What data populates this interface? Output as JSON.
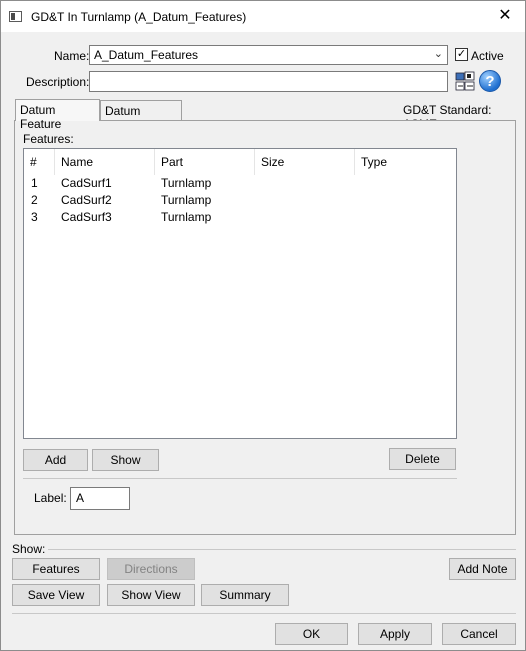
{
  "window": {
    "title": "GD&T In Turnlamp (A_Datum_Features)",
    "close_glyph": "✕"
  },
  "form": {
    "name_label": "Name:",
    "name_value": "A_Datum_Features",
    "active_label": "Active",
    "active_checked": true,
    "description_label": "Description:",
    "description_value": ""
  },
  "tabs": [
    {
      "label": "Datum Feature",
      "selected": true
    },
    {
      "label": "Datum Targets",
      "selected": false
    }
  ],
  "standard_label": "GD&T Standard: ASME",
  "features": {
    "label": "Features:",
    "columns": [
      "#",
      "Name",
      "Part",
      "Size",
      "Type"
    ],
    "rows": [
      {
        "num": "1",
        "name": "CadSurf1",
        "part": "Turnlamp",
        "size": "",
        "type": ""
      },
      {
        "num": "2",
        "name": "CadSurf2",
        "part": "Turnlamp",
        "size": "",
        "type": ""
      },
      {
        "num": "3",
        "name": "CadSurf3",
        "part": "Turnlamp",
        "size": "",
        "type": ""
      }
    ]
  },
  "buttons": {
    "add": "Add",
    "show": "Show",
    "delete": "Delete",
    "features": "Features",
    "directions": "Directions",
    "add_note": "Add Note",
    "save_view": "Save View",
    "show_view": "Show View",
    "summary": "Summary",
    "ok": "OK",
    "apply": "Apply",
    "cancel": "Cancel"
  },
  "datum_label": {
    "label": "Label:",
    "value": "A"
  },
  "show_section_label": "Show:",
  "icons": {
    "window": "window-icon",
    "datum-grid": "datum-grid-icon",
    "help": "help-icon",
    "dropdown": "chevron-down-icon"
  }
}
